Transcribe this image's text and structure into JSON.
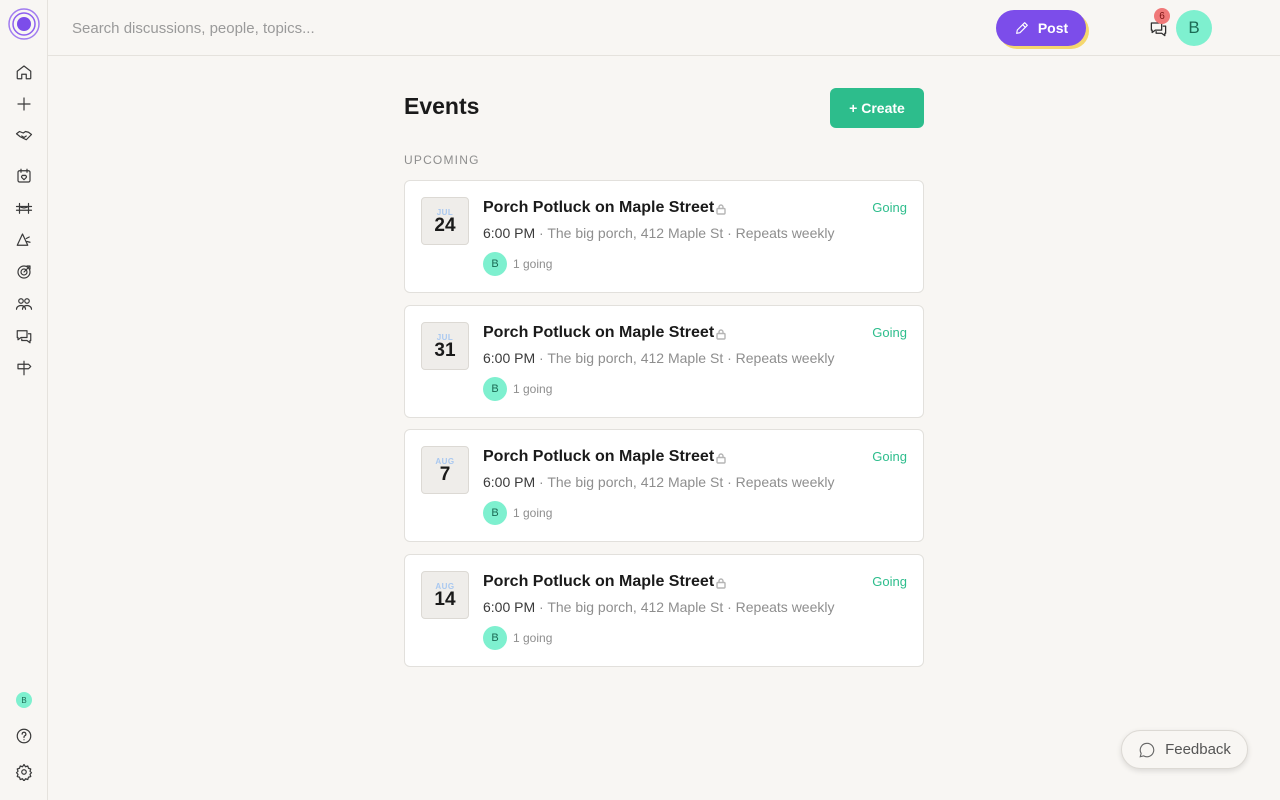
{
  "search": {
    "placeholder": "Search discussions, people, topics..."
  },
  "header": {
    "post_label": "Post",
    "notification_count": "6",
    "user_initial": "B"
  },
  "sidebar": {
    "items": [
      {
        "icon": "home-icon"
      },
      {
        "icon": "plus-icon"
      },
      {
        "icon": "handshake-icon"
      },
      {
        "icon": "calendar-heart-icon"
      },
      {
        "icon": "bridge-icon"
      },
      {
        "icon": "shapes-icon"
      },
      {
        "icon": "target-icon"
      },
      {
        "icon": "people-icon"
      },
      {
        "icon": "chat-icon"
      },
      {
        "icon": "signpost-icon"
      }
    ],
    "user_initial": "B",
    "help_icon": "help-icon",
    "settings_icon": "gear-icon"
  },
  "page": {
    "title": "Events",
    "create_label": "+ Create",
    "section_label": "UPCOMING"
  },
  "events": [
    {
      "month": "JUL",
      "day": "24",
      "title": "Porch Potluck on Maple Street",
      "status": "Going",
      "time": "6:00 PM",
      "location": " · The big porch, 412 Maple St · ",
      "repeat": " Repeats weekly",
      "attendee_initial": "B",
      "attendees": "1 going"
    },
    {
      "month": "JUL",
      "day": "31",
      "title": "Porch Potluck on Maple Street",
      "status": "Going",
      "time": "6:00 PM",
      "location": " · The big porch, 412 Maple St · ",
      "repeat": " Repeats weekly",
      "attendee_initial": "B",
      "attendees": "1 going"
    },
    {
      "month": "AUG",
      "day": "7",
      "title": "Porch Potluck on Maple Street",
      "status": "Going",
      "time": "6:00 PM",
      "location": " · The big porch, 412 Maple St · ",
      "repeat": " Repeats weekly",
      "attendee_initial": "B",
      "attendees": "1 going"
    },
    {
      "month": "AUG",
      "day": "14",
      "title": "Porch Potluck on Maple Street",
      "status": "Going",
      "time": "6:00 PM",
      "location": " · The big porch, 412 Maple St · ",
      "repeat": " Repeats weekly",
      "attendee_initial": "B",
      "attendees": "1 going"
    }
  ],
  "feedback": {
    "label": "Feedback"
  },
  "colors": {
    "accent_purple": "#7c4dea",
    "accent_green": "#2dbd8c",
    "avatar_mint": "#7ef0cf",
    "badge_red": "#f07878"
  }
}
